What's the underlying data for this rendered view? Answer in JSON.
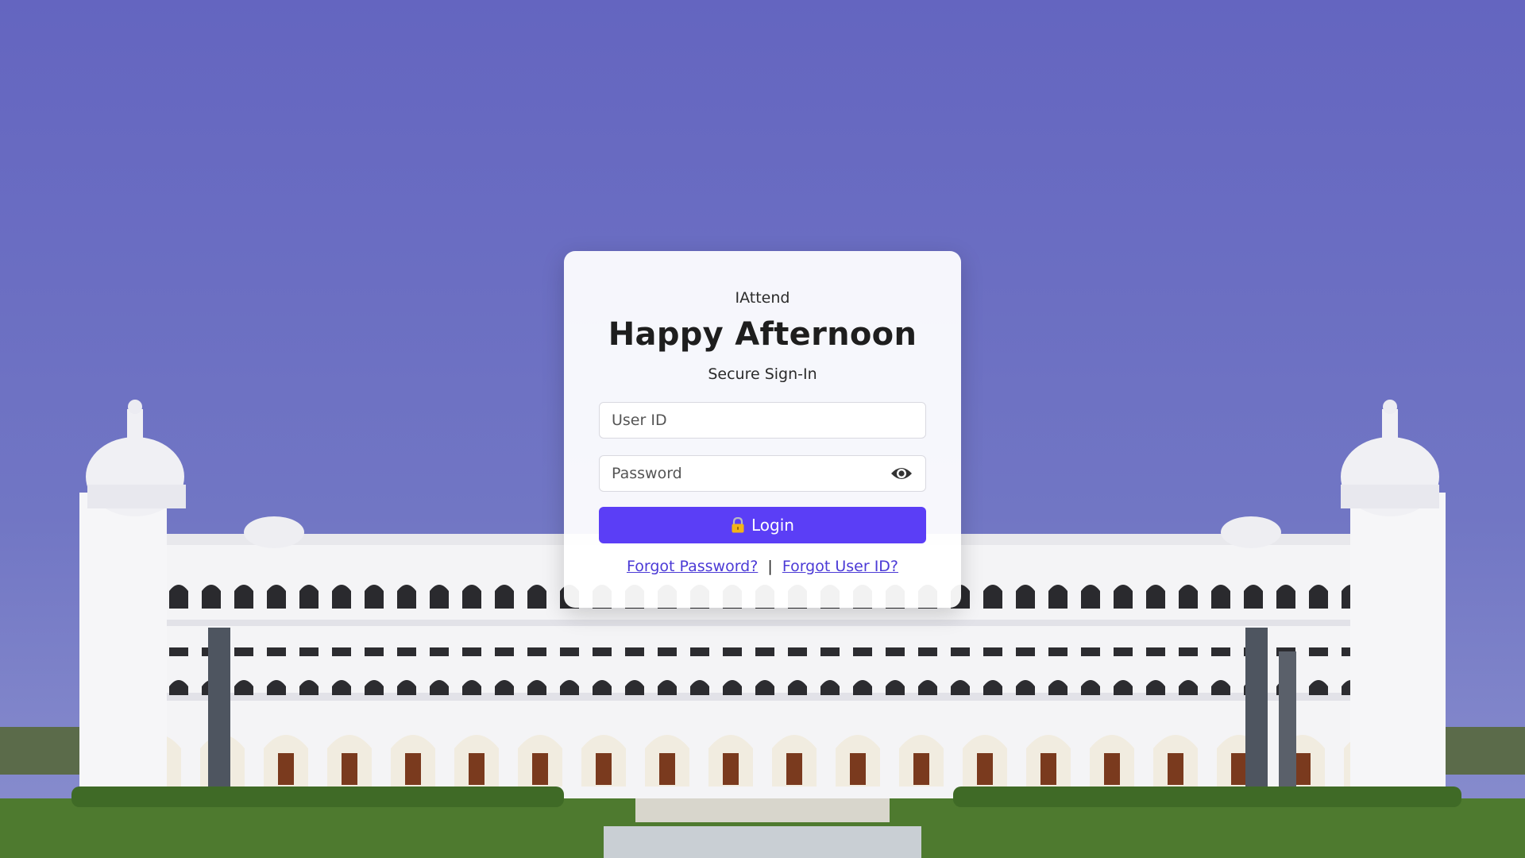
{
  "login": {
    "app_name": "IAttend",
    "greeting": "Happy Afternoon",
    "subtitle": "Secure Sign-In",
    "user_id_placeholder": "User ID",
    "password_placeholder": "Password",
    "login_label": "Login",
    "forgot_password": "Forgot Password?",
    "separator": "|",
    "forgot_user_id": "Forgot User ID?"
  },
  "icons": {
    "password_toggle": "eye-icon",
    "login_button": "lock-icon"
  },
  "colors": {
    "sky": "#6a6bc6",
    "accent": "#5b3ef6",
    "link": "#4b3ad6",
    "card": "#ffffff"
  }
}
